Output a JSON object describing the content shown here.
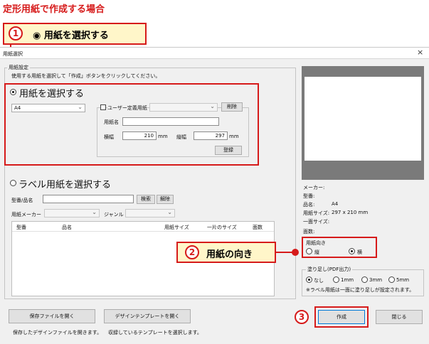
{
  "heading": "定形用紙で作成する場合",
  "step1": {
    "number": "1",
    "label": "◉ 用紙を選択する"
  },
  "step2": {
    "number": "2",
    "label": "用紙の向き"
  },
  "step3": {
    "number": "3"
  },
  "dialog": {
    "title": "用紙選択",
    "close_label": "×",
    "section_label": "用紙設定",
    "instruction": "使用する用紙を選択して「作成」ボタンをクリックしてください。",
    "select_paper": {
      "label": "用紙を選択する",
      "size_value": "A4",
      "user_defined_label": "ユーザー定義用紙",
      "delete_label": "削除",
      "paper_name_label": "用紙名",
      "width_label": "横幅",
      "width_value": "210",
      "width_unit": "mm",
      "height_label": "縦幅",
      "height_value": "297",
      "height_unit": "mm",
      "register_label": "登録"
    },
    "select_label": {
      "label": "ラベル用紙を選択する",
      "model_label": "型番/品名",
      "search_label": "検索",
      "clear_label": "解除",
      "maker_label": "用紙メーカー",
      "genre_label": "ジャンル",
      "columns": [
        "型番",
        "品名",
        "用紙サイズ",
        "一片のサイズ",
        "面数"
      ]
    },
    "info": {
      "maker_label": "メーカー:",
      "model_label": "型番:",
      "name_label": "品名:",
      "name_value": "A4",
      "size_label": "用紙サイズ:",
      "size_value": "297 x 210 mm",
      "piece_label": "一面サイズ:",
      "faces_label": "面数:"
    },
    "orientation": {
      "label": "用紙向き",
      "portrait_label": "縦",
      "landscape_label": "横",
      "selected": "landscape"
    },
    "bleed": {
      "label": "塗り足し(PDF出力)",
      "options": [
        "なし",
        "1mm",
        "3mm",
        "5mm"
      ],
      "selected": "なし",
      "note": "※ラベル用紙は一面に塗り足しが設定されます。"
    },
    "buttons": {
      "open_saved": "保存ファイルを開く",
      "open_saved_desc": "保存したデザインファイルを開きます。",
      "open_template": "デザインテンプレートを開く",
      "open_template_desc": "収録しているテンプレートを選択します。",
      "create": "作成",
      "close": "閉じる"
    }
  }
}
